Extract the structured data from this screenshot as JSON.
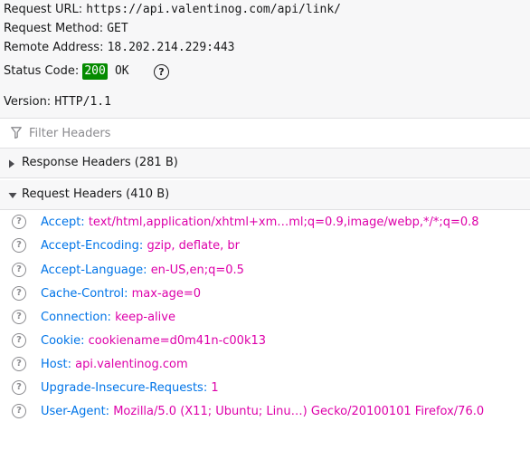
{
  "summary": {
    "request_url_label": "Request URL:",
    "request_url": "https://api.valentinog.com/api/link/",
    "method_label": "Request Method:",
    "method": "GET",
    "remote_label": "Remote Address:",
    "remote": "18.202.214.229:443",
    "status_label": "Status Code:",
    "status_code": "200",
    "status_text": "OK",
    "help_glyph": "?",
    "version_label": "Version:",
    "version": "HTTP/1.1"
  },
  "filter": {
    "placeholder": "Filter Headers",
    "value": ""
  },
  "response_headers": {
    "label": "Response Headers (281 B)",
    "expanded": false
  },
  "request_headers": {
    "label": "Request Headers (410 B)",
    "expanded": true,
    "items": [
      {
        "name": "Accept:",
        "value": "text/html,application/xhtml+xm…ml;q=0.9,image/webp,*/*;q=0.8"
      },
      {
        "name": "Accept-Encoding:",
        "value": "gzip, deflate, br"
      },
      {
        "name": "Accept-Language:",
        "value": "en-US,en;q=0.5"
      },
      {
        "name": "Cache-Control:",
        "value": "max-age=0"
      },
      {
        "name": "Connection:",
        "value": "keep-alive"
      },
      {
        "name": "Cookie:",
        "value": "cookiename=d0m41n-c00k13"
      },
      {
        "name": "Host:",
        "value": "api.valentinog.com"
      },
      {
        "name": "Upgrade-Insecure-Requests:",
        "value": "1"
      },
      {
        "name": "User-Agent:",
        "value": "Mozilla/5.0 (X11; Ubuntu; Linu…) Gecko/20100101 Firefox/76.0"
      }
    ]
  },
  "colors": {
    "header_name": "#0074e8",
    "header_value": "#dd00a9",
    "status_badge": "#058b00"
  },
  "icons": {
    "filter": "filter-icon",
    "collapsed": "triangle-right-icon",
    "expanded": "triangle-down-icon",
    "help": "question-circle-icon"
  }
}
